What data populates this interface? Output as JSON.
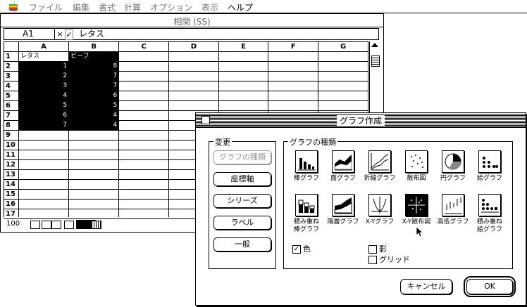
{
  "menubar": {
    "items": [
      "ファイル",
      "編集",
      "書式",
      "計算",
      "オプション",
      "表示",
      "ヘルプ"
    ]
  },
  "spreadsheet": {
    "title": "相関 (SS)",
    "cell_ref": "A1",
    "cancel_glyph": "×",
    "confirm_glyph": "✓",
    "entry_value": "レタス",
    "columns": [
      "A",
      "B",
      "C",
      "D",
      "E",
      "F",
      "G"
    ],
    "rows": [
      {
        "n": "1",
        "a": "レタス",
        "b": "ビーフ"
      },
      {
        "n": "2",
        "a": "1",
        "b": "8"
      },
      {
        "n": "3",
        "a": "2",
        "b": "7"
      },
      {
        "n": "4",
        "a": "3",
        "b": "7"
      },
      {
        "n": "5",
        "a": "4",
        "b": "6"
      },
      {
        "n": "6",
        "a": "5",
        "b": "5"
      },
      {
        "n": "7",
        "a": "6",
        "b": "4"
      },
      {
        "n": "8",
        "a": "7",
        "b": "4"
      },
      {
        "n": "9",
        "a": "",
        "b": ""
      },
      {
        "n": "10",
        "a": "",
        "b": ""
      },
      {
        "n": "11",
        "a": "",
        "b": ""
      },
      {
        "n": "12",
        "a": "",
        "b": ""
      },
      {
        "n": "13",
        "a": "",
        "b": ""
      },
      {
        "n": "14",
        "a": "",
        "b": ""
      },
      {
        "n": "15",
        "a": "",
        "b": ""
      },
      {
        "n": "16",
        "a": "",
        "b": ""
      },
      {
        "n": "17",
        "a": "",
        "b": ""
      }
    ],
    "zoom": "100"
  },
  "dialog": {
    "title": "グラフ作成",
    "change_label": "変更",
    "change_buttons": [
      "グラフの種類",
      "座標軸",
      "シリーズ",
      "ラベル",
      "一般"
    ],
    "types_label": "グラフの種類",
    "types": [
      {
        "label": "棒グラフ",
        "icon": "bar-chart-icon"
      },
      {
        "label": "面グラフ",
        "icon": "area-chart-icon"
      },
      {
        "label": "折線グラフ",
        "icon": "line-chart-icon"
      },
      {
        "label": "散布図",
        "icon": "scatter-chart-icon"
      },
      {
        "label": "円グラフ",
        "icon": "pie-chart-icon"
      },
      {
        "label": "絵グラフ",
        "icon": "pictograph-chart-icon"
      },
      {
        "label": "積み重ね\n棒グラフ",
        "icon": "stacked-bar-chart-icon"
      },
      {
        "label": "階層グラフ",
        "icon": "layered-area-chart-icon"
      },
      {
        "label": "X-Yグラフ",
        "icon": "xy-line-chart-icon"
      },
      {
        "label": "X-Y散布図",
        "icon": "xy-scatter-chart-icon"
      },
      {
        "label": "高低グラフ",
        "icon": "high-low-chart-icon"
      },
      {
        "label": "積み重ね\n絵グラフ",
        "icon": "stacked-pictograph-chart-icon"
      }
    ],
    "selected_type": "X-Y散布図",
    "checkboxes": [
      {
        "label": "色",
        "checked": true
      },
      {
        "label": "影",
        "checked": false
      },
      {
        "label": "グリッド",
        "checked": false
      }
    ],
    "cancel_label": "キャンセル",
    "ok_label": "OK"
  }
}
